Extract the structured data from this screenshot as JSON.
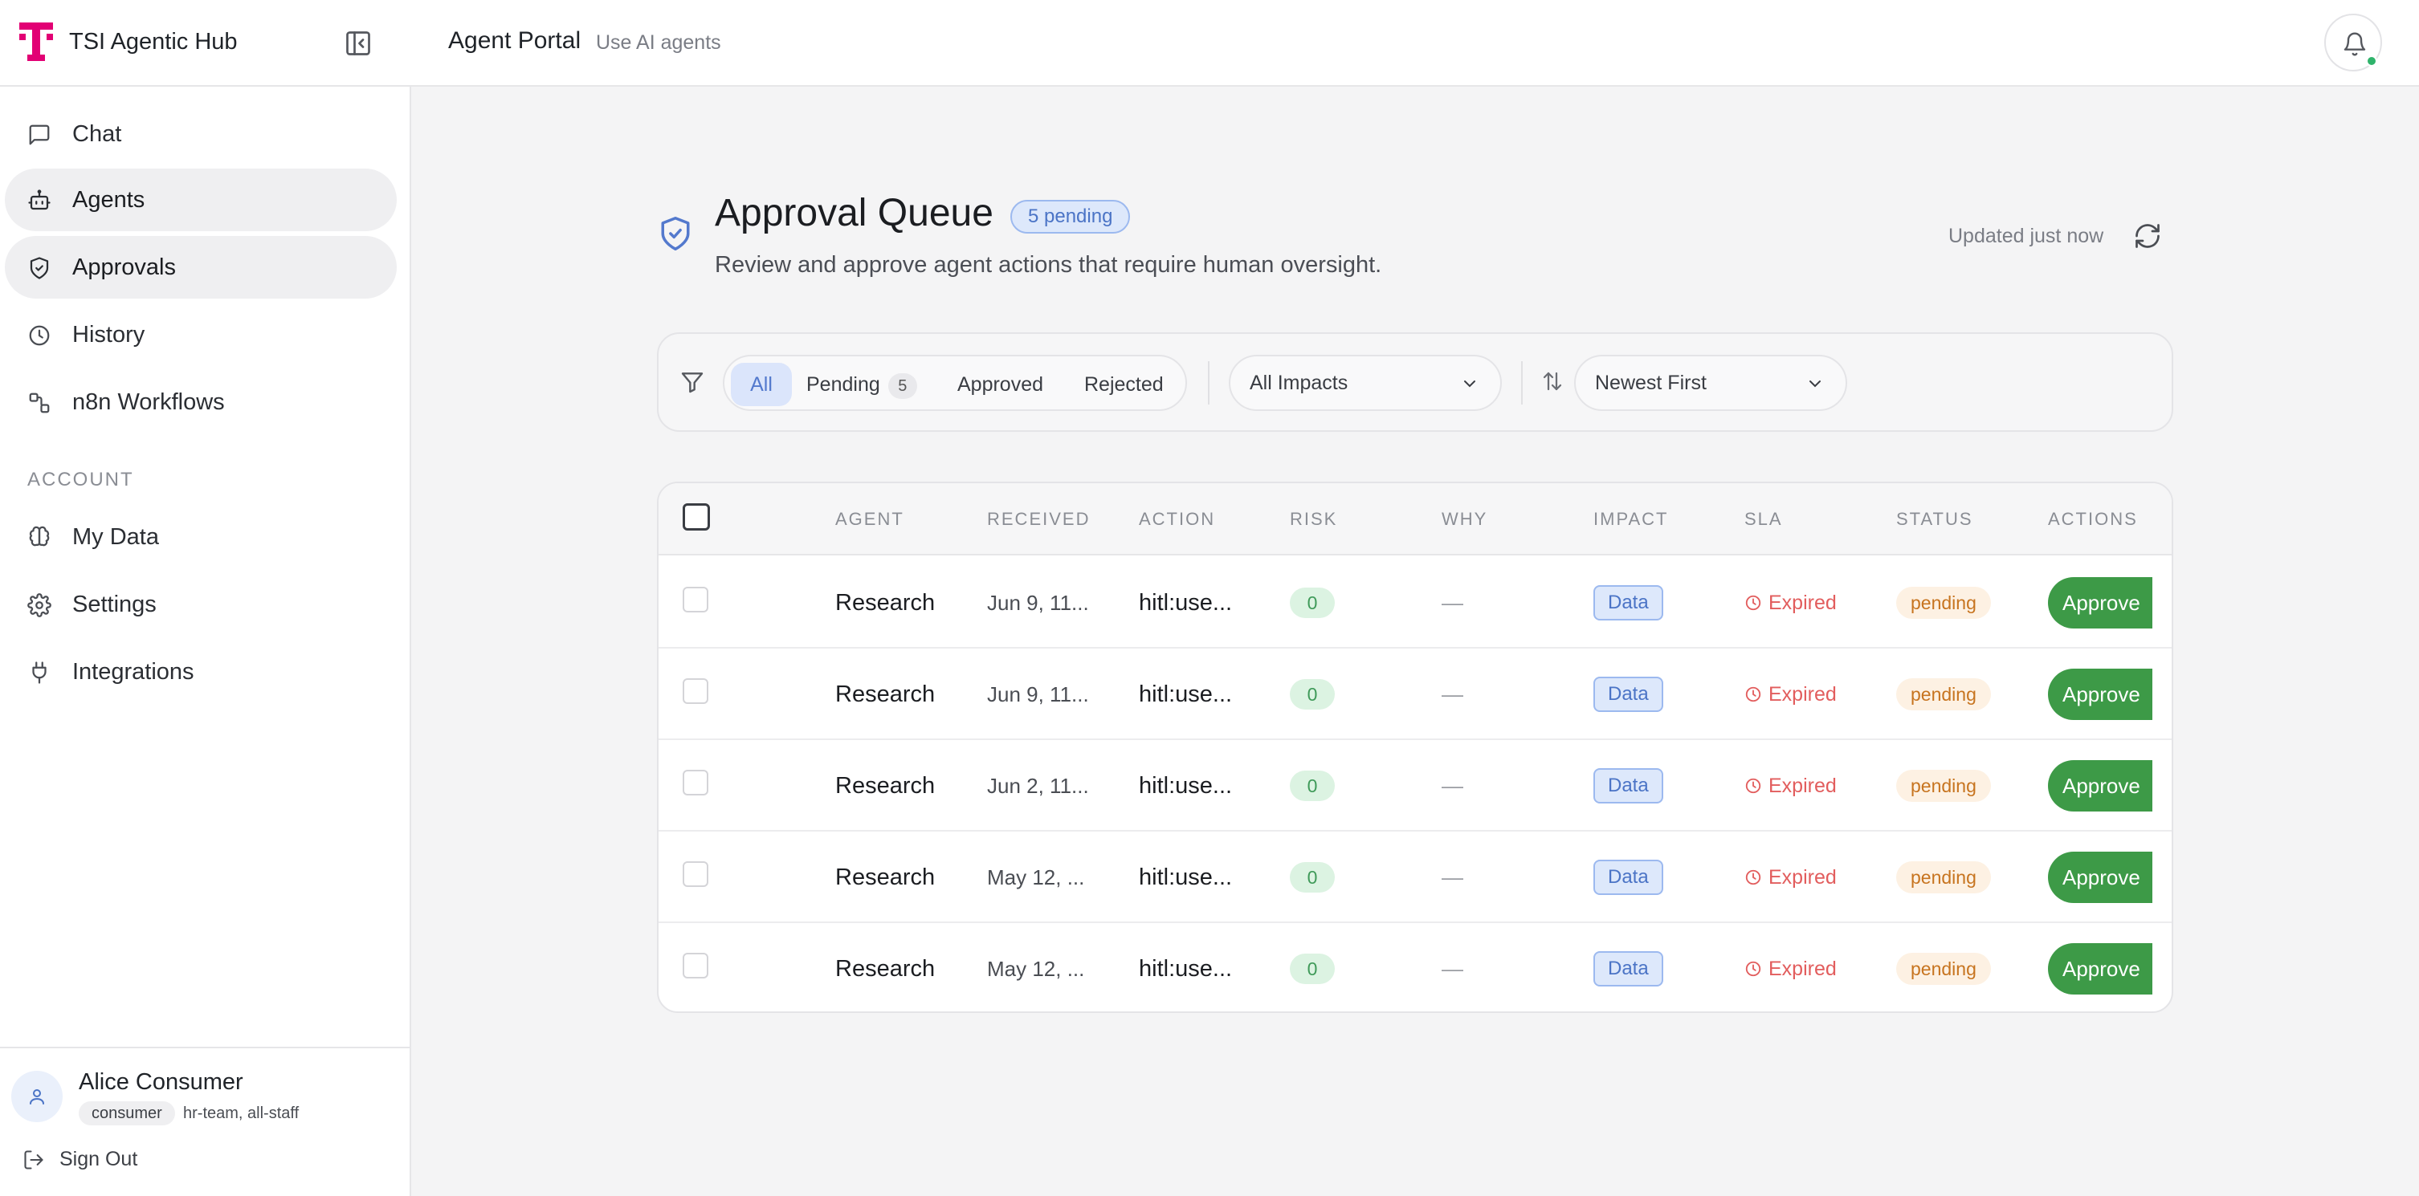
{
  "header": {
    "app_name": "TSI Agentic Hub",
    "portal_title": "Agent Portal",
    "portal_subtitle": "Use AI agents"
  },
  "colors": {
    "brand": "#e20074",
    "accent": "#5379cd",
    "approve": "#3d9a47",
    "expired": "#e25d5d",
    "pending": "#c7741f"
  },
  "sidebar": {
    "items": [
      {
        "label": "Chat",
        "icon": "chat-icon",
        "active": false
      },
      {
        "label": "Agents",
        "icon": "bot-icon",
        "active": true
      },
      {
        "label": "Approvals",
        "icon": "shield-check-icon",
        "active": true
      },
      {
        "label": "History",
        "icon": "clock-icon",
        "active": false
      },
      {
        "label": "n8n Workflows",
        "icon": "workflow-icon",
        "active": false
      }
    ],
    "account_section_label": "ACCOUNT",
    "account_items": [
      {
        "label": "My Data",
        "icon": "brain-icon"
      },
      {
        "label": "Settings",
        "icon": "gear-icon"
      },
      {
        "label": "Integrations",
        "icon": "plug-icon"
      }
    ],
    "user": {
      "name": "Alice Consumer",
      "role": "consumer",
      "groups": "hr-team, all-staff"
    },
    "sign_out_label": "Sign Out"
  },
  "main": {
    "title": "Approval Queue",
    "pending_badge": "5 pending",
    "subtitle": "Review and approve agent actions that require human oversight.",
    "updated": "Updated just now",
    "filters": {
      "tabs": [
        {
          "label": "All",
          "selected": true
        },
        {
          "label": "Pending",
          "count": "5"
        },
        {
          "label": "Approved"
        },
        {
          "label": "Rejected"
        }
      ],
      "impact_select": "All Impacts",
      "sort_select": "Newest First"
    },
    "table": {
      "columns": [
        "AGENT",
        "RECEIVED",
        "ACTION",
        "RISK",
        "WHY",
        "IMPACT",
        "SLA",
        "STATUS",
        "ACTIONS"
      ],
      "rows": [
        {
          "agent": "Research",
          "received": "Jun 9, 11...",
          "action": "hitl:use...",
          "risk": "0",
          "why": "—",
          "impact": "Data",
          "sla": "Expired",
          "status": "pending",
          "action_label": "Approve"
        },
        {
          "agent": "Research",
          "received": "Jun 9, 11...",
          "action": "hitl:use...",
          "risk": "0",
          "why": "—",
          "impact": "Data",
          "sla": "Expired",
          "status": "pending",
          "action_label": "Approve"
        },
        {
          "agent": "Research",
          "received": "Jun 2, 11...",
          "action": "hitl:use...",
          "risk": "0",
          "why": "—",
          "impact": "Data",
          "sla": "Expired",
          "status": "pending",
          "action_label": "Approve"
        },
        {
          "agent": "Research",
          "received": "May 12, ...",
          "action": "hitl:use...",
          "risk": "0",
          "why": "—",
          "impact": "Data",
          "sla": "Expired",
          "status": "pending",
          "action_label": "Approve"
        },
        {
          "agent": "Research",
          "received": "May 12, ...",
          "action": "hitl:use...",
          "risk": "0",
          "why": "—",
          "impact": "Data",
          "sla": "Expired",
          "status": "pending",
          "action_label": "Approve"
        }
      ]
    }
  }
}
